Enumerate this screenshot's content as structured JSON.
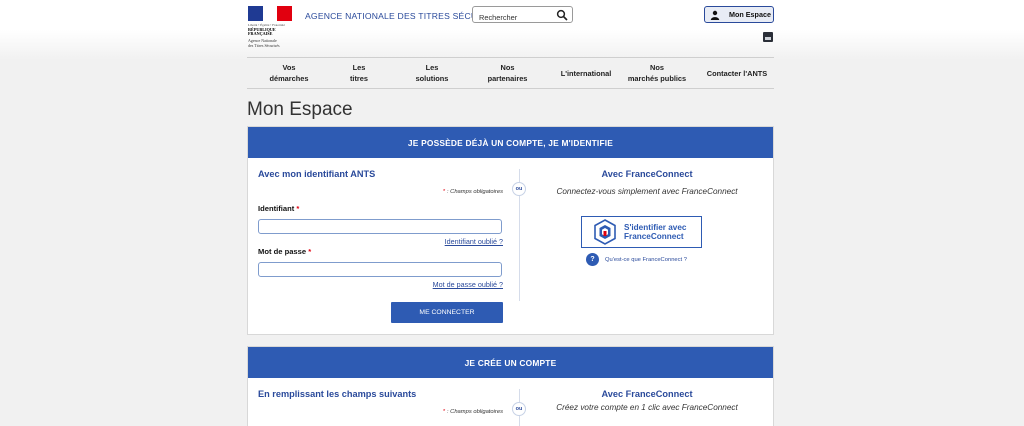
{
  "header": {
    "logo_motto": "Liberté • Égalité • Fraternité",
    "logo_republic": "RÉPUBLIQUE FRANÇAISE",
    "logo_agency_line1": "Agence Nationale",
    "logo_agency_line2": "des Titres Sécurisés",
    "agency_title": "AGENCE NATIONALE DES TITRES SÉCURISÉS",
    "search_placeholder": "Rechercher",
    "mon_espace_label": "Mon Espace"
  },
  "nav": {
    "items": [
      {
        "label": "Vos\ndémarches"
      },
      {
        "label": "Les\ntitres"
      },
      {
        "label": "Les\nsolutions"
      },
      {
        "label": "Nos\npartenaires"
      },
      {
        "label": "L'international"
      },
      {
        "label": "Nos\nmarchés publics"
      },
      {
        "label": "Contacter l'ANTS"
      }
    ]
  },
  "page_title": "Mon Espace",
  "login_panel": {
    "header": "JE POSSÈDE DÉJÀ UN COMPTE, JE M'IDENTIFIE",
    "left_title": "Avec mon identifiant ANTS",
    "required_star": "*",
    "required_note": " : Champs obligatoires",
    "identifiant_label": "Identifiant",
    "identifiant_value": "",
    "identifiant_forgot": "Identifiant oublié ?",
    "password_label": "Mot de passe",
    "password_value": "",
    "password_forgot": "Mot de passe oublié ?",
    "connect_button": "ME CONNECTER",
    "ou": "ou",
    "fc_title": "Avec FranceConnect",
    "fc_subtitle": "Connectez-vous simplement avec FranceConnect",
    "fc_button_line1": "S'identifier avec",
    "fc_button_line2": "FranceConnect",
    "fc_help_icon": "?",
    "fc_help": "Qu'est-ce que FranceConnect ?"
  },
  "create_panel": {
    "header": "JE CRÉE UN COMPTE",
    "left_title": "En remplissant les champs suivants",
    "required_star": "*",
    "required_note": " : Champs obligatoires",
    "ou": "ou",
    "fc_title": "Avec FranceConnect",
    "fc_subtitle": "Créez votre compte en 1 clic avec FranceConnect"
  },
  "colors": {
    "primary": "#2e5bb3",
    "link": "#2a4a9b",
    "required": "#e1000f"
  }
}
